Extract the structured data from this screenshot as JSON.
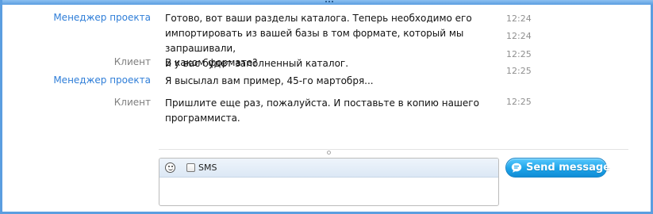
{
  "colors": {
    "frame_border": "#5b9ee0",
    "manager_name": "#2f7ed8",
    "client_name": "#7f7f7f",
    "send_button": "#1ea3e8"
  },
  "conversation": {
    "messages": [
      {
        "sender": "Менеджер проекта",
        "role": "manager",
        "lines": [
          "Готово, вот ваши разделы каталога. Теперь необходимо его",
          "импортировать из вашей базы в том формате, который мы запрашивали,",
          "и у вас будет заполненный каталог."
        ],
        "times": [
          "12:24",
          "12:24",
          "12:25"
        ]
      },
      {
        "sender": "Клиент",
        "role": "client",
        "lines": [
          "В каком формате?"
        ],
        "times": [
          "12:25"
        ]
      },
      {
        "sender": "Менеджер проекта",
        "role": "manager",
        "lines": [
          "Я высылал вам пример, 45-го мартобря..."
        ],
        "times": []
      },
      {
        "sender": "Клиент",
        "role": "client",
        "lines": [
          "Пришлите еще раз, пожалуйста. И поставьте в копию нашего",
          "программиста."
        ],
        "times": [
          "12:25"
        ]
      }
    ]
  },
  "compose": {
    "emoticon_icon": "smiley-icon",
    "sms_label": "SMS",
    "sms_checked": false,
    "input_value": "",
    "send_icon": "chat-bubble-icon",
    "send_label": "Send message"
  }
}
